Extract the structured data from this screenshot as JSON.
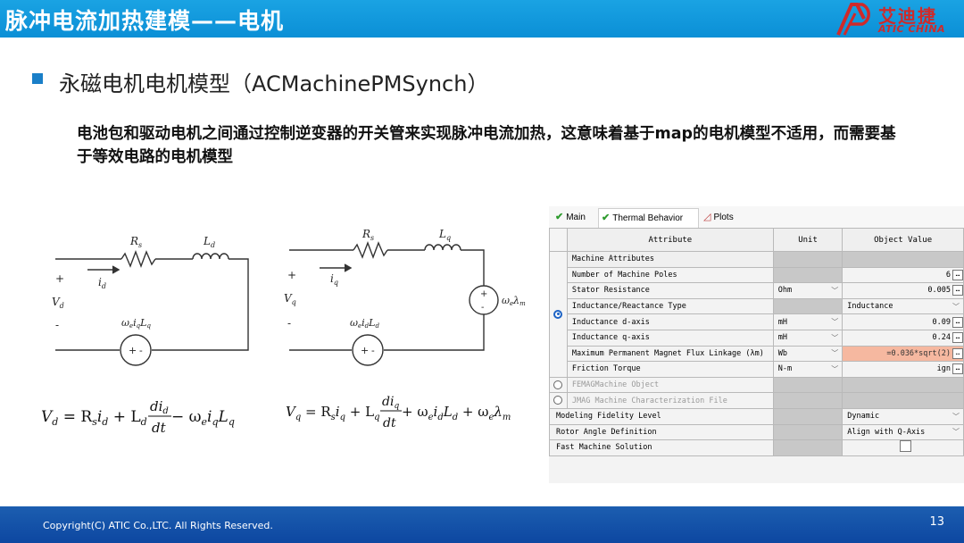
{
  "slide": {
    "title": "脉冲电流加热建模——电机",
    "heading": "永磁电机电机模型（ACMachinePMSynch）",
    "paragraph": "电池包和驱动电机之间通过控制逆变器的开关管来实现脉冲电流加热，这意味着基于map的电机模型不适用，而需要基于等效电路的电机模型",
    "footer": "Copyright(C) ATIC Co.,LTC. All Rights Reserved.",
    "page_number": "13"
  },
  "logo": {
    "cn": "艾迪捷",
    "en": "ATIC CHINA",
    "color": "#cf2a2a"
  },
  "circuits": {
    "d": {
      "rs": "R",
      "rs_sub": "s",
      "l": "L",
      "l_sub": "d",
      "current": "i",
      "current_sub": "d",
      "plus": "+",
      "minus": "-",
      "v": "V",
      "v_sub": "d",
      "src": "ω",
      "src_rest": "e",
      "src_i": "i",
      "src_i_sub": "q",
      "src_l": "L",
      "src_l_sub": "q",
      "eq": [
        "V",
        "d",
        " = R",
        "s",
        "i",
        "d",
        " + L",
        "d",
        "di",
        "d",
        "dt",
        " − ω",
        "e",
        "i",
        "q",
        "L",
        "q"
      ]
    },
    "q": {
      "rs": "R",
      "rs_sub": "s",
      "l": "L",
      "l_sub": "q",
      "current": "i",
      "current_sub": "q",
      "plus": "+",
      "minus": "-",
      "v": "V",
      "v_sub": "q",
      "src": "ω",
      "src_rest": "e",
      "src_i": "i",
      "src_i_sub": "d",
      "src_l": "L",
      "src_l_sub": "d",
      "emf": "ω",
      "emf_e": "e",
      "emf_l": "λ",
      "emf_m": "m",
      "eq": [
        "V",
        "q",
        " = R",
        "s",
        "i",
        "q",
        " + L",
        "q",
        "di",
        "q",
        "dt",
        " + ω",
        "e",
        "i",
        "d",
        "L",
        "d",
        " + ω",
        "e",
        "λ",
        "m"
      ]
    }
  },
  "panel": {
    "tabs": [
      {
        "label": "Main",
        "icon": "check-icon"
      },
      {
        "label": "Thermal Behavior",
        "icon": "check-icon"
      },
      {
        "label": "Plots",
        "icon": "plot-icon"
      }
    ],
    "headers": [
      "Attribute",
      "Unit",
      "Object Value"
    ],
    "rows": [
      {
        "attr": "Machine Attributes",
        "unit": "",
        "value": "",
        "kind": "section"
      },
      {
        "attr": "Number of Machine Poles",
        "unit": "",
        "value": "6",
        "kind": "num"
      },
      {
        "attr": "Stator Resistance",
        "unit": "Ohm",
        "value": "0.005",
        "kind": "num"
      },
      {
        "attr": "Inductance/Reactance Type",
        "unit": "",
        "value": "Inductance",
        "kind": "select"
      },
      {
        "attr": "Inductance d-axis",
        "unit": "mH",
        "value": "0.09",
        "kind": "num"
      },
      {
        "attr": "Inductance q-axis",
        "unit": "mH",
        "value": "0.24",
        "kind": "num"
      },
      {
        "attr": "Maximum Permanent Magnet Flux Linkage (λm)",
        "unit": "Wb",
        "value": "=0.036*sqrt(2)",
        "kind": "highlight"
      },
      {
        "attr": "Friction Torque",
        "unit": "N-m",
        "value": "ign",
        "kind": "num"
      },
      {
        "attr": "FEMAGMachine Object",
        "unit": "",
        "value": "",
        "kind": "disabled"
      },
      {
        "attr": "JMAG Machine Characterization File",
        "unit": "",
        "value": "",
        "kind": "disabled"
      },
      {
        "attr": "Modeling Fidelity Level",
        "unit": "",
        "value": "Dynamic",
        "kind": "select"
      },
      {
        "attr": "Rotor Angle Definition",
        "unit": "",
        "value": "Align with Q-Axis",
        "kind": "select"
      },
      {
        "attr": "Fast Machine Solution",
        "unit": "",
        "value": "",
        "kind": "checkbox"
      }
    ]
  }
}
